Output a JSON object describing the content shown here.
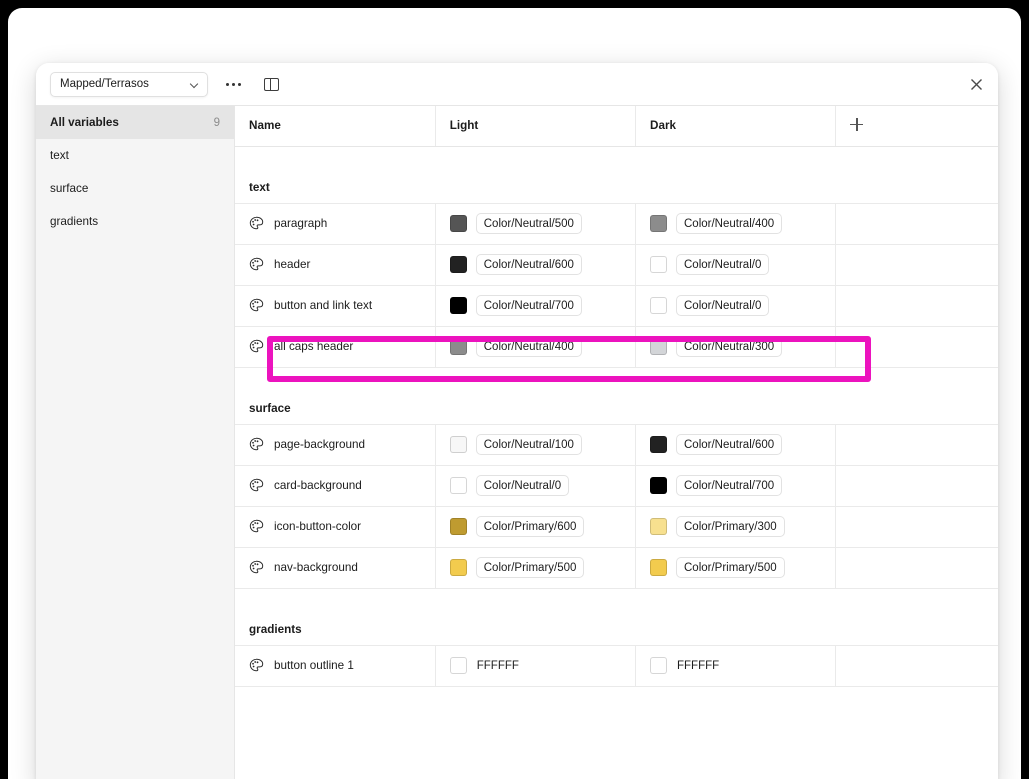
{
  "modal": {
    "collection": {
      "label": "Mapped/Terrasos",
      "icon": "chevron-down-icon"
    },
    "more_menu_icon": "ellipsis-icon",
    "panel_toggle_icon": "sidebar-panel-icon",
    "close_icon": "close-icon"
  },
  "sidebar": {
    "items": [
      {
        "label": "All variables",
        "count": "9",
        "active": true
      },
      {
        "label": "text",
        "count": "",
        "active": false
      },
      {
        "label": "surface",
        "count": "",
        "active": false
      },
      {
        "label": "gradients",
        "count": "",
        "active": false
      }
    ]
  },
  "table": {
    "columns": {
      "name": "Name",
      "light": "Light",
      "dark": "Dark",
      "add_icon": "plus-icon"
    },
    "groups": [
      {
        "name": "text",
        "rows": [
          {
            "icon": "color-palette-icon",
            "name": "paragraph",
            "light": {
              "value": "Color/Neutral/500",
              "swatch": "#555555",
              "boxed": true
            },
            "dark": {
              "value": "Color/Neutral/400",
              "swatch": "#8c8c8c",
              "boxed": true
            },
            "highlighted": false
          },
          {
            "icon": "color-palette-icon",
            "name": "header",
            "light": {
              "value": "Color/Neutral/600",
              "swatch": "#222222",
              "boxed": true
            },
            "dark": {
              "value": "Color/Neutral/0",
              "swatch": "#ffffff",
              "boxed": true
            },
            "highlighted": false
          },
          {
            "icon": "color-palette-icon",
            "name": "button and link text",
            "light": {
              "value": "Color/Neutral/700",
              "swatch": "#000000",
              "boxed": true
            },
            "dark": {
              "value": "Color/Neutral/0",
              "swatch": "#ffffff",
              "boxed": true
            },
            "highlighted": true
          },
          {
            "icon": "color-palette-icon",
            "name": "all caps header",
            "light": {
              "value": "Color/Neutral/400",
              "swatch": "#8c8c8c",
              "boxed": true
            },
            "dark": {
              "value": "Color/Neutral/300",
              "swatch": "#d3d5d8",
              "boxed": true
            },
            "highlighted": false
          }
        ]
      },
      {
        "name": "surface",
        "rows": [
          {
            "icon": "color-palette-icon",
            "name": "page-background",
            "light": {
              "value": "Color/Neutral/100",
              "swatch": "#f7f7f7",
              "boxed": true
            },
            "dark": {
              "value": "Color/Neutral/600",
              "swatch": "#222222",
              "boxed": true
            },
            "highlighted": false
          },
          {
            "icon": "color-palette-icon",
            "name": "card-background",
            "light": {
              "value": "Color/Neutral/0",
              "swatch": "#ffffff",
              "boxed": true
            },
            "dark": {
              "value": "Color/Neutral/700",
              "swatch": "#000000",
              "boxed": true
            },
            "highlighted": false
          },
          {
            "icon": "color-palette-icon",
            "name": "icon-button-color",
            "light": {
              "value": "Color/Primary/600",
              "swatch": "#bf9b30",
              "boxed": true
            },
            "dark": {
              "value": "Color/Primary/300",
              "swatch": "#f7e08f",
              "boxed": true
            },
            "highlighted": false
          },
          {
            "icon": "color-palette-icon",
            "name": "nav-background",
            "light": {
              "value": "Color/Primary/500",
              "swatch": "#f2cb4e",
              "boxed": true
            },
            "dark": {
              "value": "Color/Primary/500",
              "swatch": "#f2cb4e",
              "boxed": true
            },
            "highlighted": false
          }
        ]
      },
      {
        "name": "gradients",
        "rows": [
          {
            "icon": "color-palette-icon",
            "name": "button outline 1",
            "light": {
              "value": "FFFFFF",
              "swatch": "#ffffff",
              "boxed": false
            },
            "dark": {
              "value": "FFFFFF",
              "swatch": "#ffffff",
              "boxed": false
            },
            "highlighted": false
          }
        ]
      }
    ]
  },
  "colors": {
    "highlight_outline": "#EC13BE",
    "sidebar_bg": "#f5f5f5",
    "sidebar_active_bg": "#e5e5e5",
    "border": "#eaeaea"
  }
}
